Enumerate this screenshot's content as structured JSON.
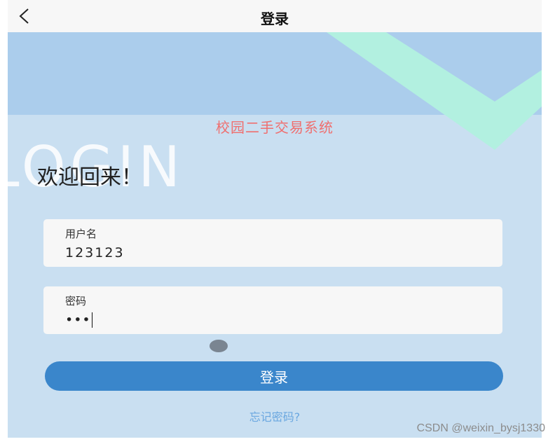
{
  "header": {
    "back_icon": "chevron-left-icon",
    "title": "登录"
  },
  "app_name": "校园二手交易系统",
  "watermark_text": "LOGIN",
  "welcome": "欢迎回来！",
  "form": {
    "username": {
      "label": "用户名",
      "value": "123123"
    },
    "password": {
      "label": "密码",
      "value": "•••"
    },
    "toggle_icon": "eye-toggle-icon",
    "submit_label": "登录",
    "forgot_label": "忘记密码?"
  },
  "page_watermark": "CSDN @weixin_bysj1330",
  "colors": {
    "header_bg": "#f7f7f7",
    "banner": "#abcdec",
    "background": "#c9dff1",
    "accent_stripe": "#b2f0e0",
    "app_name": "#ef6f6f",
    "button": "#3a86cb",
    "link": "#6aa7e0"
  }
}
